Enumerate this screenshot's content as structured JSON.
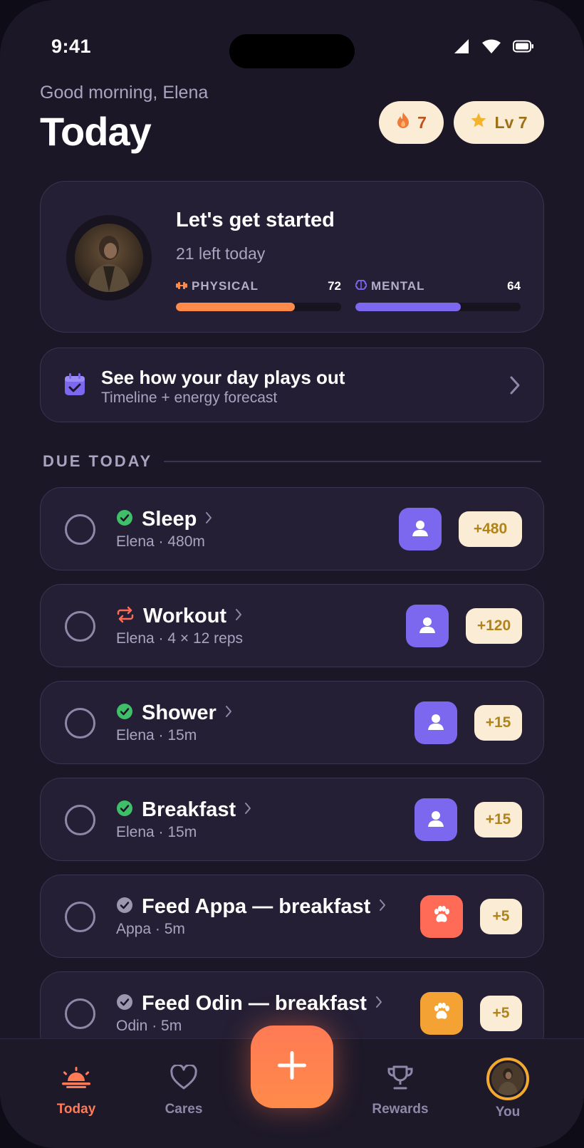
{
  "status_bar": {
    "time": "9:41"
  },
  "header": {
    "greeting": "Good morning, Elena",
    "title": "Today",
    "streak": "7",
    "level": "Lv 7"
  },
  "hero": {
    "title": "Let's get started",
    "subtitle": "21 left today",
    "physical": {
      "label": "PHYSICAL",
      "value": "72",
      "level": 0.72,
      "color": "#ff8a4a"
    },
    "mental": {
      "label": "MENTAL",
      "value": "64",
      "level": 0.64,
      "color": "#7b68ee"
    }
  },
  "timeline": {
    "title": "See how your day plays out",
    "subtitle": "Timeline + energy forecast"
  },
  "section_label": "DUE TODAY",
  "tasks": [
    {
      "name": "Sleep",
      "status_icon": "check-circle-green",
      "subtitle": "Elena · 480m",
      "assignee_icon": "person-icon",
      "assignee_color": "#7b68ee",
      "points": "+480"
    },
    {
      "name": "Workout",
      "status_icon": "repeat-icon",
      "subtitle": "Elena · 4 × 12 reps",
      "assignee_icon": "person-icon",
      "assignee_color": "#7b68ee",
      "points": "+120"
    },
    {
      "name": "Shower",
      "status_icon": "check-circle-green",
      "subtitle": "Elena · 15m",
      "assignee_icon": "person-icon",
      "assignee_color": "#7b68ee",
      "points": "+15"
    },
    {
      "name": "Breakfast",
      "status_icon": "check-circle-green",
      "subtitle": "Elena · 15m",
      "assignee_icon": "person-icon",
      "assignee_color": "#7b68ee",
      "points": "+15"
    },
    {
      "name": "Feed Appa — breakfast",
      "status_icon": "check-circle-gray",
      "subtitle": "Appa · 5m",
      "assignee_icon": "paw-icon",
      "assignee_color": "#ff6b57",
      "points": "+5"
    },
    {
      "name": "Feed Odin — breakfast",
      "status_icon": "check-circle-gray",
      "subtitle": "Odin · 5m",
      "assignee_icon": "paw-icon",
      "assignee_color": "#f5a235",
      "points": "+5"
    }
  ],
  "nav": {
    "today": "Today",
    "cares": "Cares",
    "rewards": "Rewards",
    "you": "You"
  },
  "colors": {
    "accent": "#ff7a55",
    "background": "#1b1727",
    "card": "#241f34",
    "points_bg": "#fbecd6"
  }
}
